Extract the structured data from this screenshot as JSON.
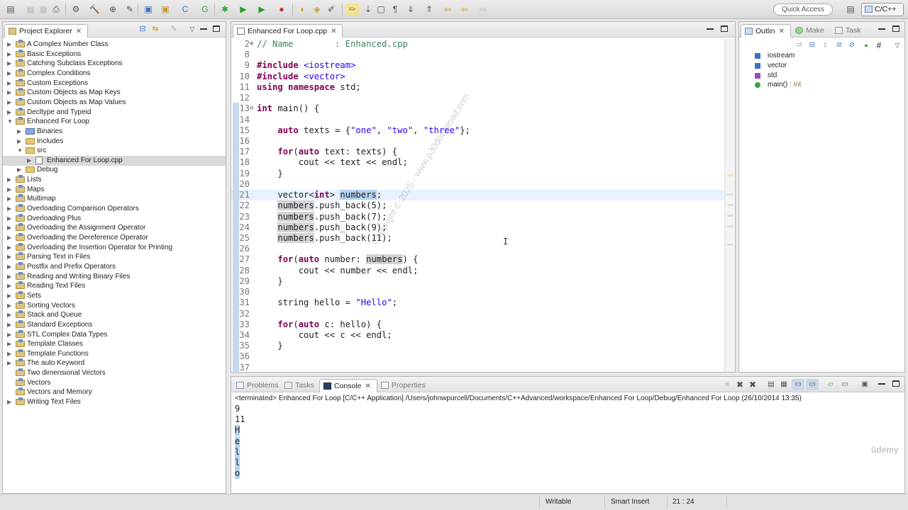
{
  "toolbar": {
    "quick_access": "Quick Access",
    "perspective": "C/C++"
  },
  "project_explorer": {
    "tab_label": "Project Explorer",
    "items": [
      {
        "label": "A Complex Number Class",
        "depth": 0,
        "type": "project",
        "expanded": false
      },
      {
        "label": "Basic Exceptions",
        "depth": 0,
        "type": "project",
        "expanded": false
      },
      {
        "label": "Catching Subclass Exceptions",
        "depth": 0,
        "type": "project",
        "expanded": false
      },
      {
        "label": "Complex Conditions",
        "depth": 0,
        "type": "project",
        "expanded": false
      },
      {
        "label": "Custom Exceptions",
        "depth": 0,
        "type": "project",
        "expanded": false
      },
      {
        "label": "Custom Objects as Map Keys",
        "depth": 0,
        "type": "project",
        "expanded": false
      },
      {
        "label": "Custom Objects as Map Values",
        "depth": 0,
        "type": "project",
        "expanded": false
      },
      {
        "label": "Decltype and Typeid",
        "depth": 0,
        "type": "project",
        "expanded": false
      },
      {
        "label": "Enhanced For Loop",
        "depth": 0,
        "type": "project",
        "expanded": true
      },
      {
        "label": "Binaries",
        "depth": 1,
        "type": "bin",
        "expanded": false
      },
      {
        "label": "Includes",
        "depth": 1,
        "type": "folder",
        "expanded": false
      },
      {
        "label": "src",
        "depth": 1,
        "type": "folder",
        "expanded": true
      },
      {
        "label": "Enhanced For Loop.cpp",
        "depth": 2,
        "type": "file",
        "expanded": false,
        "selected": true
      },
      {
        "label": "Debug",
        "depth": 1,
        "type": "folder",
        "expanded": false
      },
      {
        "label": "Lists",
        "depth": 0,
        "type": "project",
        "expanded": false
      },
      {
        "label": "Maps",
        "depth": 0,
        "type": "project",
        "expanded": false
      },
      {
        "label": "Multimap",
        "depth": 0,
        "type": "project",
        "expanded": false
      },
      {
        "label": "Overloading Comparison Operators",
        "depth": 0,
        "type": "project",
        "expanded": false
      },
      {
        "label": "Overloading Plus",
        "depth": 0,
        "type": "project",
        "expanded": false
      },
      {
        "label": "Overloading the Assignment Operator",
        "depth": 0,
        "type": "project",
        "expanded": false
      },
      {
        "label": "Overloading the Dereference Operator",
        "depth": 0,
        "type": "project",
        "expanded": false
      },
      {
        "label": "Overloading the Insertion Operator for Printing",
        "depth": 0,
        "type": "project",
        "expanded": false
      },
      {
        "label": "Parsing Text in Files",
        "depth": 0,
        "type": "project",
        "expanded": false
      },
      {
        "label": "Postfix and Prefix Operators",
        "depth": 0,
        "type": "project",
        "expanded": false
      },
      {
        "label": "Reading and Writing Binary Files",
        "depth": 0,
        "type": "project",
        "expanded": false
      },
      {
        "label": "Reading Text Files",
        "depth": 0,
        "type": "project",
        "expanded": false
      },
      {
        "label": "Sets",
        "depth": 0,
        "type": "project",
        "expanded": false
      },
      {
        "label": "Sorting Vectors",
        "depth": 0,
        "type": "project",
        "expanded": false
      },
      {
        "label": "Stack and Queue",
        "depth": 0,
        "type": "project",
        "expanded": false
      },
      {
        "label": "Standard Exceptions",
        "depth": 0,
        "type": "project",
        "expanded": false
      },
      {
        "label": "STL Complex Data Types",
        "depth": 0,
        "type": "project",
        "expanded": false
      },
      {
        "label": "Template Classes",
        "depth": 0,
        "type": "project",
        "expanded": false
      },
      {
        "label": "Template Functions",
        "depth": 0,
        "type": "project",
        "expanded": false
      },
      {
        "label": "The auto Keyword",
        "depth": 0,
        "type": "project",
        "expanded": false
      },
      {
        "label": "Two dimensional Vectors",
        "depth": 0,
        "type": "project",
        "expanded": null
      },
      {
        "label": "Vectors",
        "depth": 0,
        "type": "project",
        "expanded": null
      },
      {
        "label": "Vectors and Memory",
        "depth": 0,
        "type": "project",
        "expanded": null
      },
      {
        "label": "Writing Text Files",
        "depth": 0,
        "type": "project",
        "expanded": false
      }
    ]
  },
  "editor": {
    "tab_label": "Enhanced For Loop.cpp",
    "lines": [
      {
        "n": "2",
        "fold": "⊕",
        "html": "<span class=\"cm\">// Name        : Enhanced.cpp</span>"
      },
      {
        "n": "8",
        "html": ""
      },
      {
        "n": "9",
        "html": "<span class=\"kw\">#include</span> <span class=\"str\">&lt;iostream&gt;</span>"
      },
      {
        "n": "10",
        "html": "<span class=\"kw\">#include</span> <span class=\"str\">&lt;vector&gt;</span>"
      },
      {
        "n": "11",
        "html": "<span class=\"kw\">using namespace</span> std;"
      },
      {
        "n": "12",
        "html": ""
      },
      {
        "n": "13",
        "fold": "⊖",
        "html": "<span class=\"kw\">int</span> main() {"
      },
      {
        "n": "14",
        "html": ""
      },
      {
        "n": "15",
        "html": "    <span class=\"kw\">auto</span> texts = {<span class=\"str\">\"one\"</span>, <span class=\"str\">\"two\"</span>, <span class=\"str\">\"three\"</span>};"
      },
      {
        "n": "16",
        "html": ""
      },
      {
        "n": "17",
        "html": "    <span class=\"kw\">for</span>(<span class=\"kw\">auto</span> text: texts) {"
      },
      {
        "n": "18",
        "html": "        cout &lt;&lt; text &lt;&lt; endl;"
      },
      {
        "n": "19",
        "html": "    }"
      },
      {
        "n": "20",
        "html": ""
      },
      {
        "n": "21",
        "cur": true,
        "html": "    vector&lt;<span class=\"kw\">int</span>&gt; <span class=\"selw\">numbers</span>;"
      },
      {
        "n": "22",
        "html": "    <span class=\"occ\">numbers</span>.push_back(5);"
      },
      {
        "n": "23",
        "html": "    <span class=\"occ\">numbers</span>.push_back(7);"
      },
      {
        "n": "24",
        "html": "    <span class=\"occ\">numbers</span>.push_back(9);"
      },
      {
        "n": "25",
        "html": "    <span class=\"occ\">numbers</span>.push_back(11);"
      },
      {
        "n": "26",
        "html": ""
      },
      {
        "n": "27",
        "html": "    <span class=\"kw\">for</span>(<span class=\"kw\">auto</span> number: <span class=\"occ\">numbers</span>) {"
      },
      {
        "n": "28",
        "html": "        cout &lt;&lt; number &lt;&lt; endl;"
      },
      {
        "n": "29",
        "html": "    }"
      },
      {
        "n": "30",
        "html": ""
      },
      {
        "n": "31",
        "html": "    string hello = <span class=\"str\">\"Hello\"</span>;"
      },
      {
        "n": "32",
        "html": ""
      },
      {
        "n": "33",
        "html": "    <span class=\"kw\">for</span>(<span class=\"kw\">auto</span> c: hello) {"
      },
      {
        "n": "34",
        "html": "        cout &lt;&lt; c &lt;&lt; endl;"
      },
      {
        "n": "35",
        "html": "    }"
      },
      {
        "n": "36",
        "html": ""
      },
      {
        "n": "37",
        "html": ""
      }
    ]
  },
  "outline": {
    "tabs": [
      "Outlin",
      "Make",
      "Task"
    ],
    "items": [
      {
        "label": "iostream",
        "type": "include",
        "color": "#3a6fc4"
      },
      {
        "label": "vector",
        "type": "include",
        "color": "#3a6fc4"
      },
      {
        "label": "std",
        "type": "namespace",
        "color": "#9b4fbf"
      },
      {
        "label": "main()",
        "suffix": " : int",
        "type": "function",
        "color": "#3aa63a"
      }
    ]
  },
  "console": {
    "tabs": [
      "Problems",
      "Tasks",
      "Console",
      "Properties"
    ],
    "terminated": "<terminated> Enhanced For Loop [C/C++ Application] /Users/johnwpurcell/Documents/C++Advanced/workspace/Enhanced For Loop/Debug/Enhanced For Loop (26/10/2014 13:35)",
    "output": [
      {
        "text": "9",
        "highlight": false
      },
      {
        "text": "11",
        "highlight": false
      },
      {
        "text": "H",
        "highlight": true
      },
      {
        "text": "e",
        "highlight": true
      },
      {
        "text": "l",
        "highlight": true
      },
      {
        "text": "l",
        "highlight": true
      },
      {
        "text": "o",
        "highlight": true
      }
    ]
  },
  "statusbar": {
    "writable": "Writable",
    "insert_mode": "Smart Insert",
    "position": "21 : 24"
  },
  "watermark": "Copyright © 2025 - www.p30download.com",
  "udemy_mark": "ûdemy"
}
